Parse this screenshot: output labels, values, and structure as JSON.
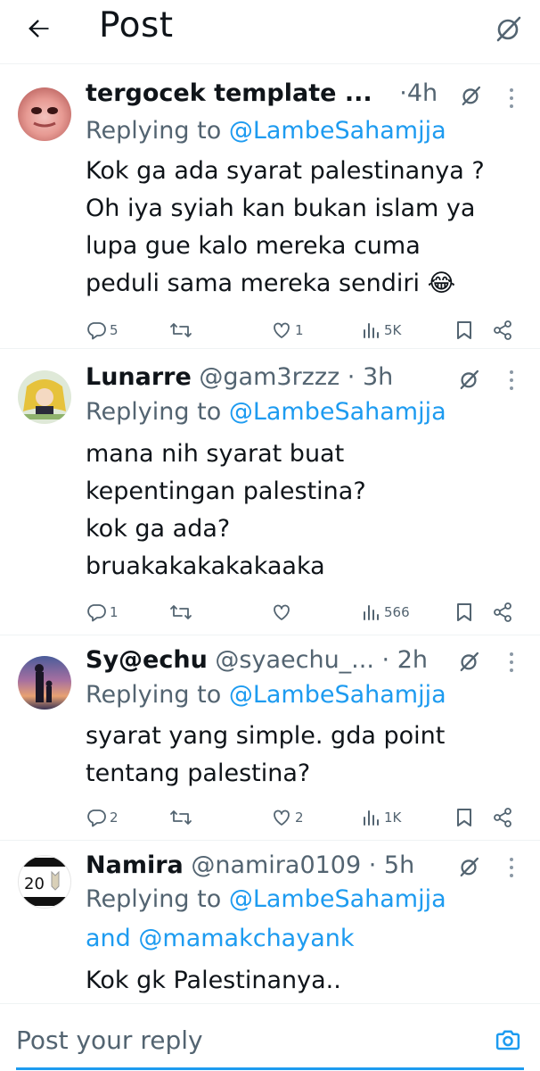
{
  "header": {
    "title": "Post",
    "back_icon": "arrow-left-icon",
    "grok_icon": "grok-icon"
  },
  "tweets": [
    {
      "name": "tergocek template ...",
      "handle": "",
      "time": "4h",
      "replying_prefix": "Replying to",
      "replying_to": "@LambeSahamjja",
      "replying_and": "",
      "replying_to_2": "",
      "lines": [
        "Kok ga ada syarat palestinanya ?",
        "Oh iya syiah kan bukan islam ya",
        "lupa gue kalo mereka cuma",
        "peduli sama mereka sendiri 😂"
      ],
      "replies": "5",
      "reposts": "",
      "likes": "1",
      "views": "5K"
    },
    {
      "name": "Lunarre",
      "handle": "@gam3rzzz",
      "time": "3h",
      "replying_prefix": "Replying to",
      "replying_to": "@LambeSahamjja",
      "replying_and": "",
      "replying_to_2": "",
      "lines": [
        "mana nih syarat buat",
        "kepentingan palestina?",
        "kok ga ada?",
        "bruakakakakakaaka"
      ],
      "replies": "1",
      "reposts": "",
      "likes": "",
      "views": "566"
    },
    {
      "name": "Sy@echu",
      "handle": "@syaechu_...",
      "time": "2h",
      "replying_prefix": "Replying to",
      "replying_to": "@LambeSahamjja",
      "replying_and": "",
      "replying_to_2": "",
      "lines": [
        "syarat yang simple. gda point",
        "tentang palestina?"
      ],
      "replies": "2",
      "reposts": "",
      "likes": "2",
      "views": "1K"
    },
    {
      "name": "Namira",
      "handle": "@namira0109",
      "time": "5h",
      "replying_prefix": "Replying to",
      "replying_to": "@LambeSahamjja",
      "replying_and": "and",
      "replying_to_2": "@mamakchayank",
      "lines": [
        "Kok gk Palestinanya.."
      ],
      "replies": "",
      "reposts": "",
      "likes": "",
      "views": "",
      "avatar_text": "20"
    }
  ],
  "reply_bar": {
    "placeholder": "Post your reply",
    "camera_icon": "camera-icon"
  },
  "colors": {
    "text": "#0f1419",
    "muted": "#536471",
    "link": "#1d9bf0",
    "divider": "#eff3f4"
  }
}
